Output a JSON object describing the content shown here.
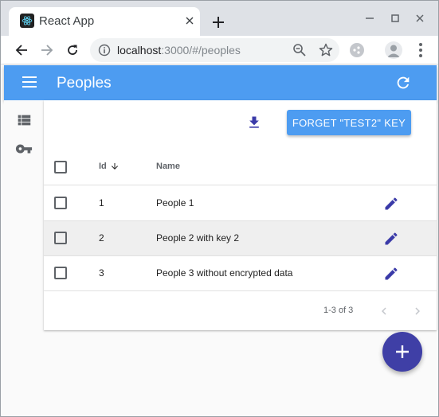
{
  "browser": {
    "tab_title": "React App",
    "url_host": "localhost",
    "url_rest": ":3000/#/peoples"
  },
  "appbar": {
    "title": "Peoples"
  },
  "toolbar": {
    "forget_button_label": "FORGET \"TEST2\" KEY"
  },
  "table": {
    "columns": {
      "id": "Id",
      "name": "Name"
    },
    "rows": [
      {
        "id": "1",
        "name": "People 1"
      },
      {
        "id": "2",
        "name": "People 2 with key 2"
      },
      {
        "id": "3",
        "name": "People 3 without encrypted data"
      }
    ]
  },
  "pagination": {
    "range_text": "1-3 of 3"
  },
  "colors": {
    "appbar": "#4d9cf1",
    "accent": "#3f3fa6",
    "icon_indigo": "#3a3aa8"
  }
}
